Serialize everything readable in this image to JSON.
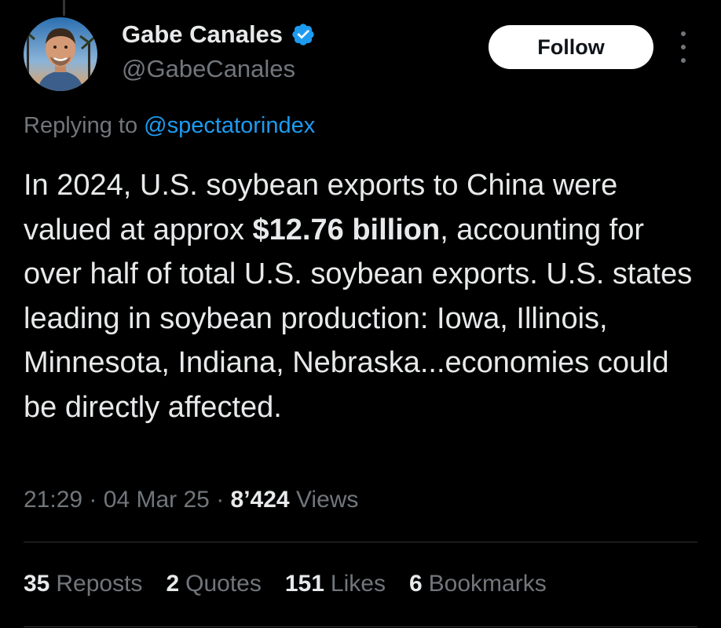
{
  "author": {
    "name": "Gabe Canales",
    "handle": "@GabeCanales",
    "verified": true,
    "verified_color": "#1d9bf0"
  },
  "follow_button": {
    "label": "Follow"
  },
  "more_menu": {
    "icon": "more-vertical-icon"
  },
  "reply": {
    "prefix": "Replying to",
    "mention": "@spectatorindex"
  },
  "tweet": {
    "text_before": "In 2024, U.S. soybean exports to China were valued at approx ",
    "text_bold": "$12.76 billion",
    "text_after": ", accounting for over half of total U.S. soybean exports. U.S. states leading in soybean production: Iowa, Illinois, Minnesota, Indiana, Nebraska...economies could be directly affected."
  },
  "meta": {
    "time": "21:29",
    "date": "04 Mar 25",
    "views_count": "8’424",
    "views_label": "Views",
    "separator": "·"
  },
  "stats": {
    "reposts_count": "35",
    "reposts_label": "Reposts",
    "quotes_count": "2",
    "quotes_label": "Quotes",
    "likes_count": "151",
    "likes_label": "Likes",
    "bookmarks_count": "6",
    "bookmarks_label": "Bookmarks"
  },
  "colors": {
    "background": "#000000",
    "text_primary": "#e7e9ea",
    "text_secondary": "#71767b",
    "link": "#1d9bf0",
    "divider": "#2f3336"
  }
}
